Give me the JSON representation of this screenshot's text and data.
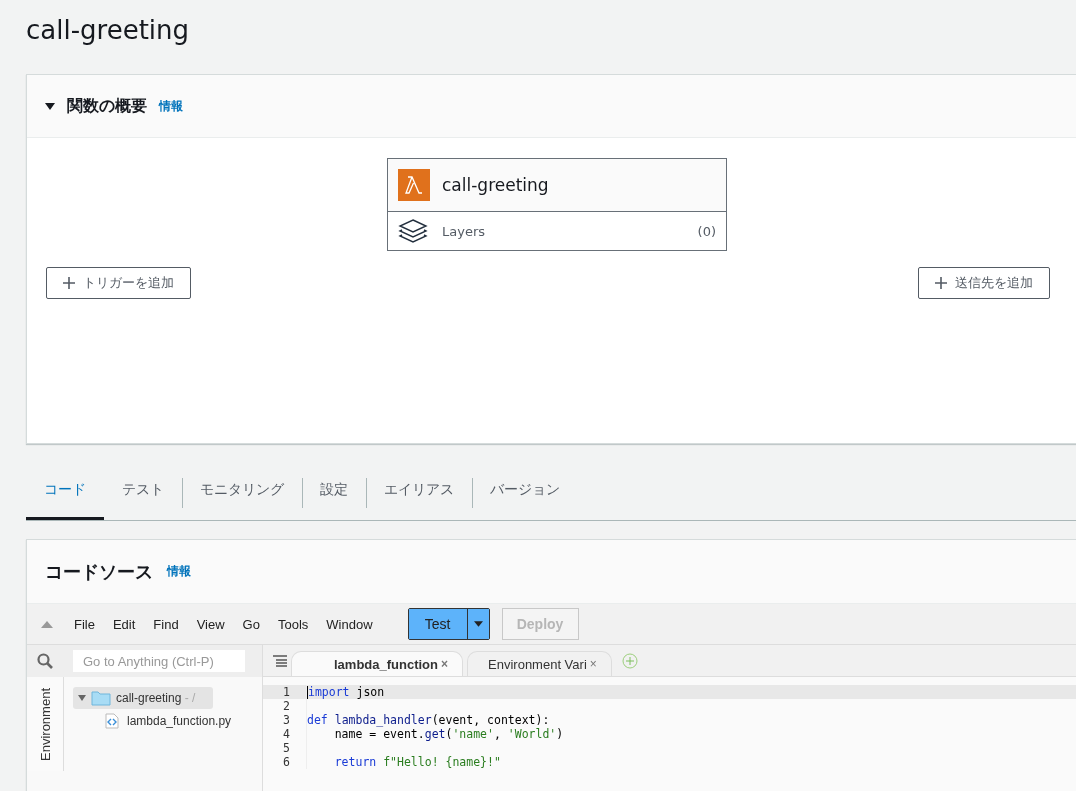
{
  "page_title": "call-greeting",
  "overview": {
    "title": "関数の概要",
    "info_link": "情報",
    "expanded": true,
    "function_name": "call-greeting",
    "layers_label": "Layers",
    "layers_count": "(0)",
    "add_trigger": "トリガーを追加",
    "add_destination": "送信先を追加"
  },
  "tabs": [
    {
      "label": "コード",
      "selected": true
    },
    {
      "label": "テスト",
      "selected": false
    },
    {
      "label": "モニタリング",
      "selected": false
    },
    {
      "label": "設定",
      "selected": false
    },
    {
      "label": "エイリアス",
      "selected": false
    },
    {
      "label": "バージョン",
      "selected": false
    }
  ],
  "code_source": {
    "title": "コードソース",
    "info_link": "情報"
  },
  "ide": {
    "menu": [
      "File",
      "Edit",
      "Find",
      "View",
      "Go",
      "Tools",
      "Window"
    ],
    "test_button": "Test",
    "deploy_button": {
      "label": "Deploy",
      "disabled": true
    },
    "search": {
      "placeholder": "Go to Anything (Ctrl-P)"
    },
    "side_tab": "Environment",
    "tree": [
      {
        "name": "call-greeting",
        "suffix": " - /",
        "expanded": true,
        "children": [
          {
            "name": "lambda_function.py"
          }
        ]
      }
    ],
    "file_tabs": [
      {
        "label": "lambda_function",
        "close": "×",
        "selected": true
      },
      {
        "label": "Environment Vari",
        "close": "×",
        "selected": false
      }
    ],
    "lines": [
      {
        "number": "1",
        "current": true,
        "tokens": [
          {
            "text": "import",
            "kind": "keyword"
          },
          {
            "text": " json",
            "kind": "plain"
          }
        ]
      },
      {
        "number": "2",
        "current": false
      },
      {
        "number": "3",
        "current": false,
        "tokens": [
          {
            "text": "def",
            "kind": "keyword"
          },
          {
            "text": " lambda_handler",
            "kind": "function"
          },
          {
            "text": "(event, context):",
            "kind": "plain"
          }
        ]
      },
      {
        "number": "4",
        "current": false,
        "tokens": [
          {
            "text": "    name = event.",
            "kind": "plain"
          },
          {
            "text": "get",
            "kind": "function"
          },
          {
            "text": "(",
            "kind": "plain"
          },
          {
            "text": "'name'",
            "kind": "string"
          },
          {
            "text": ", ",
            "kind": "plain"
          },
          {
            "text": "'World'",
            "kind": "string"
          },
          {
            "text": ")",
            "kind": "plain"
          }
        ]
      },
      {
        "number": "5",
        "current": false
      },
      {
        "number": "6",
        "current": false,
        "tokens": [
          {
            "text": "    return",
            "kind": "keyword"
          },
          {
            "text": " f\"Hello! {name}!\"",
            "kind": "string"
          }
        ]
      }
    ]
  }
}
